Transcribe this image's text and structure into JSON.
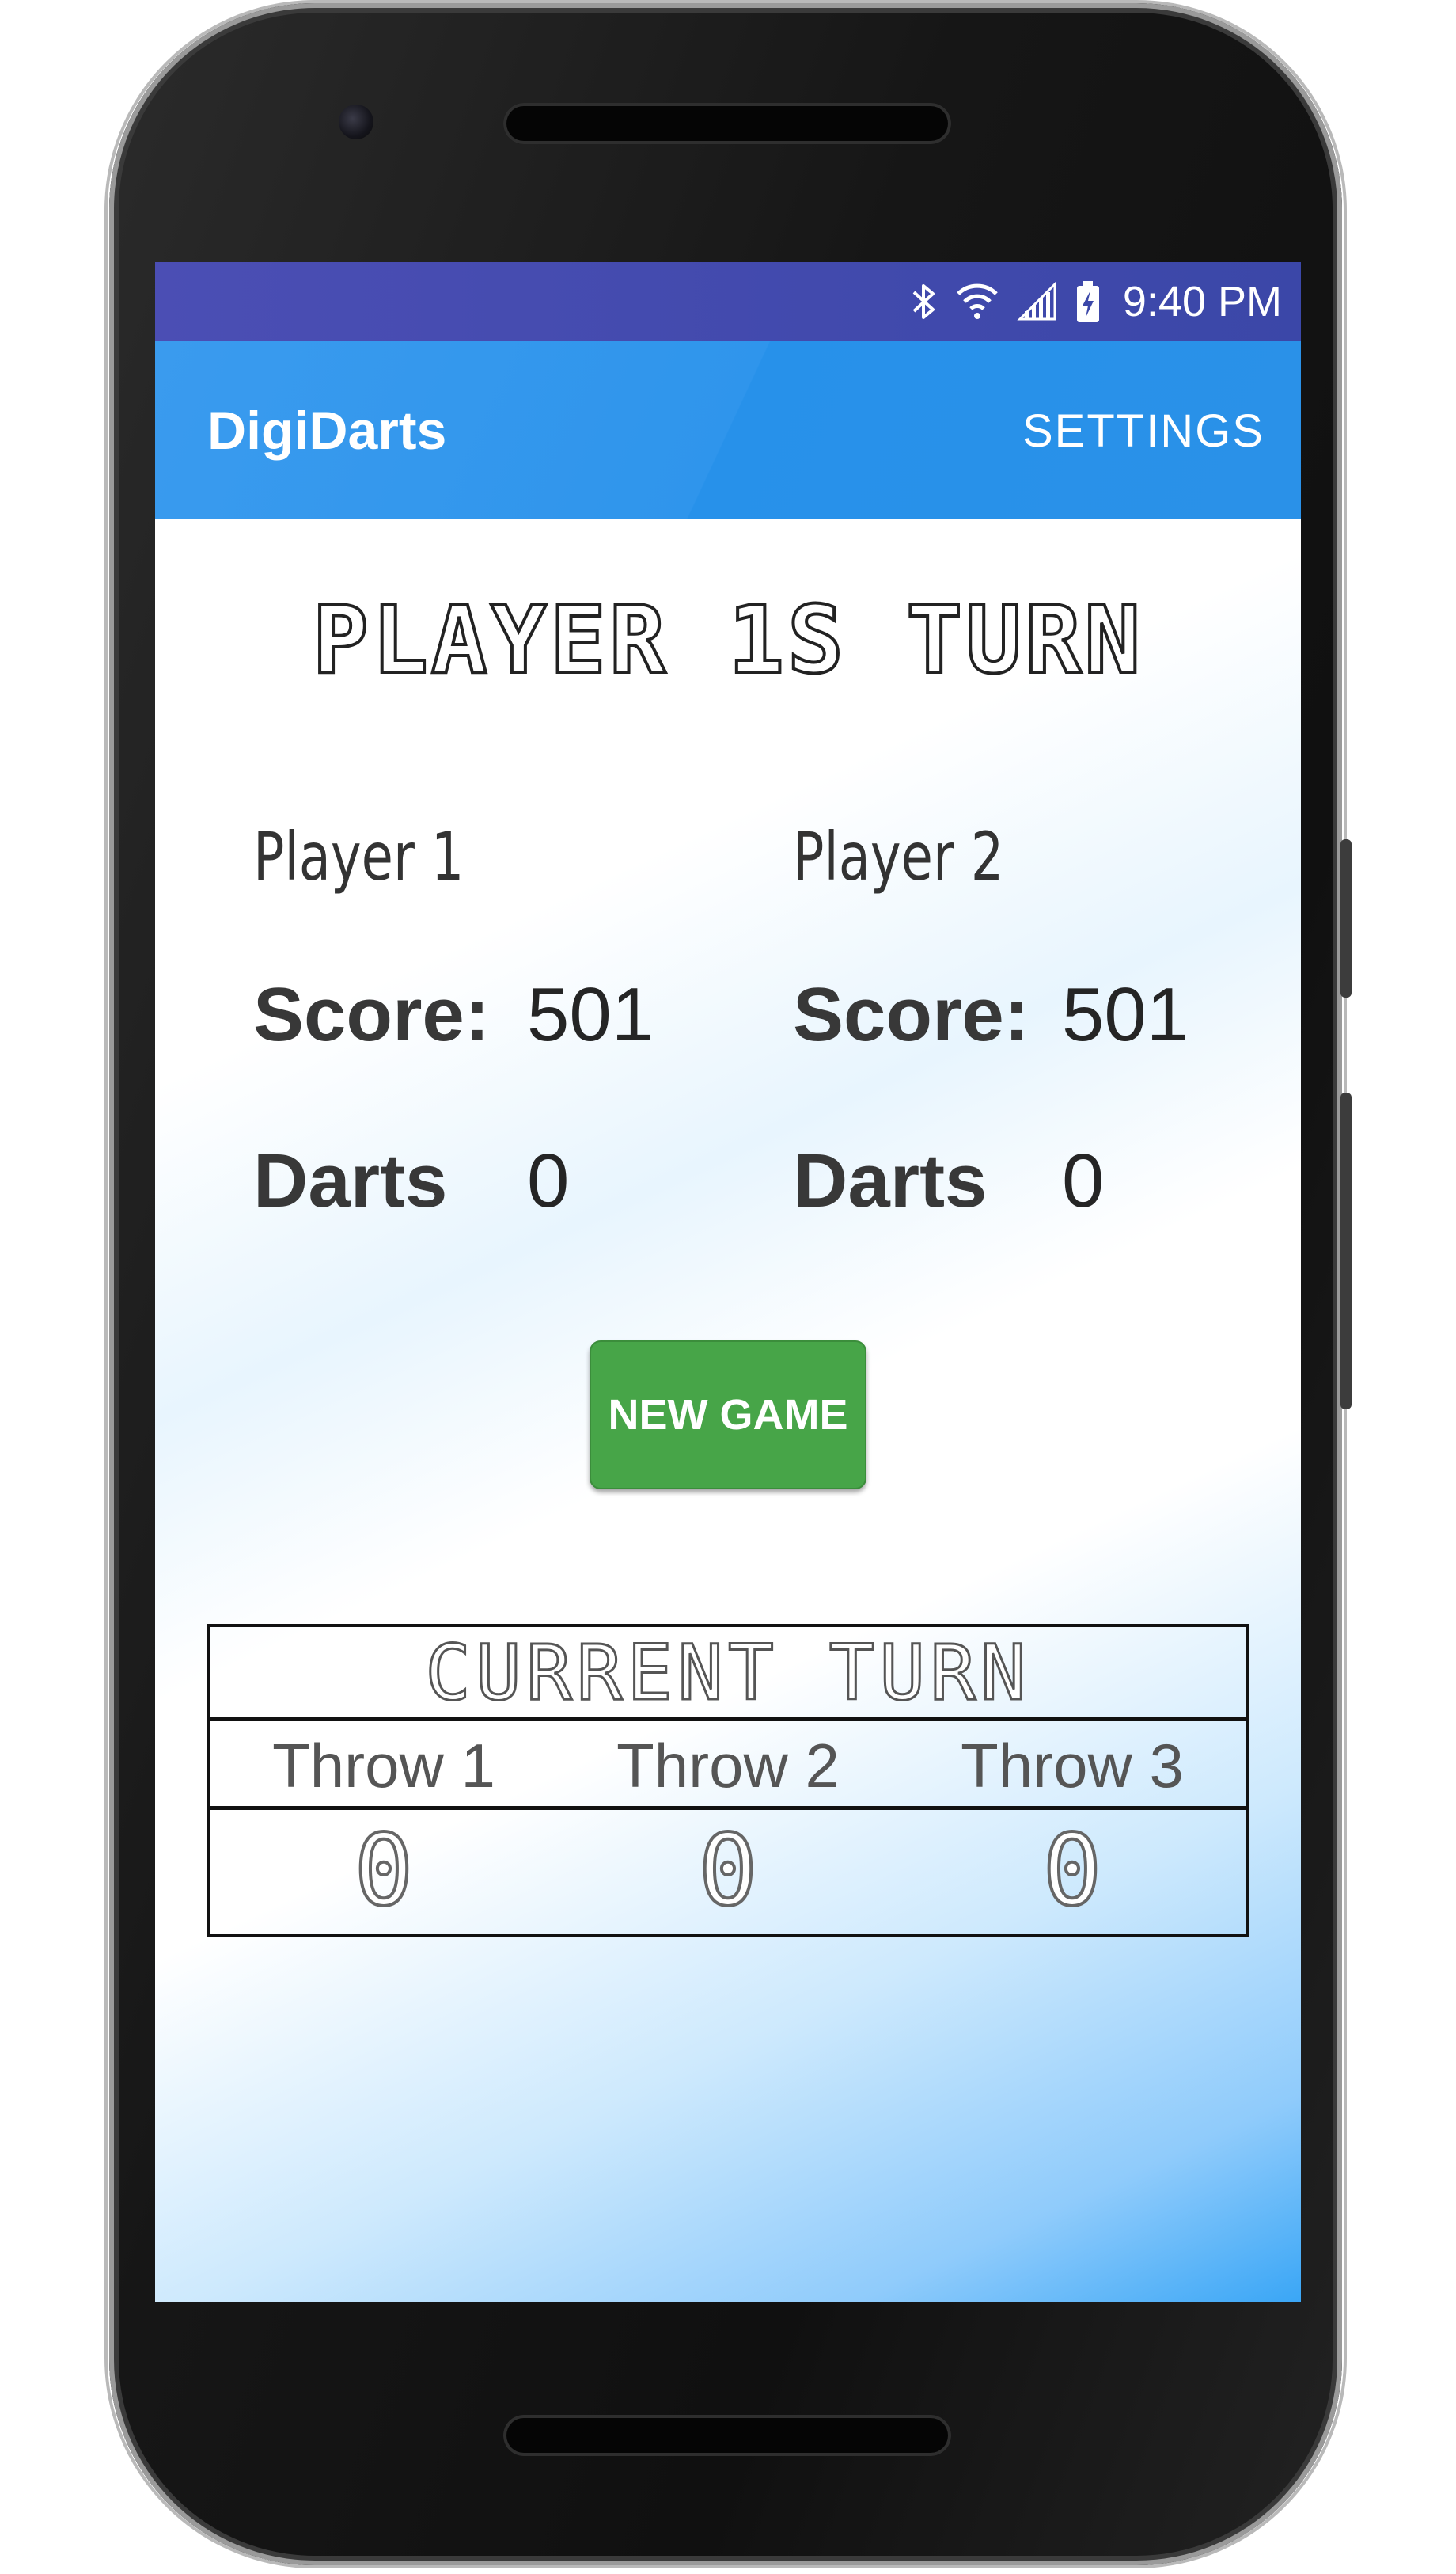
{
  "status_bar": {
    "time": "9:40 PM",
    "icons": [
      "bluetooth-icon",
      "wifi-icon",
      "signal-icon",
      "battery-charging-icon"
    ]
  },
  "app_bar": {
    "title": "DigiDarts",
    "settings_label": "SETTINGS"
  },
  "turn_heading": "PLAYER 1S TURN",
  "players": [
    {
      "name": "Player 1",
      "score_label": "Score:",
      "score": "501",
      "darts_label": "Darts",
      "darts": "0"
    },
    {
      "name": "Player 2",
      "score_label": "Score:",
      "score": "501",
      "darts_label": "Darts",
      "darts": "0"
    }
  ],
  "new_game_label": "NEW GAME",
  "current_turn": {
    "title": "CURRENT TURN",
    "throws": [
      {
        "label": "Throw 1",
        "value": "0"
      },
      {
        "label": "Throw 2",
        "value": "0"
      },
      {
        "label": "Throw 3",
        "value": "0"
      }
    ]
  },
  "colors": {
    "status_bar": "#3f4aa9",
    "app_bar": "#2f95ec",
    "new_game_button": "#47a548",
    "background_gradient": "#8fcbfb"
  }
}
